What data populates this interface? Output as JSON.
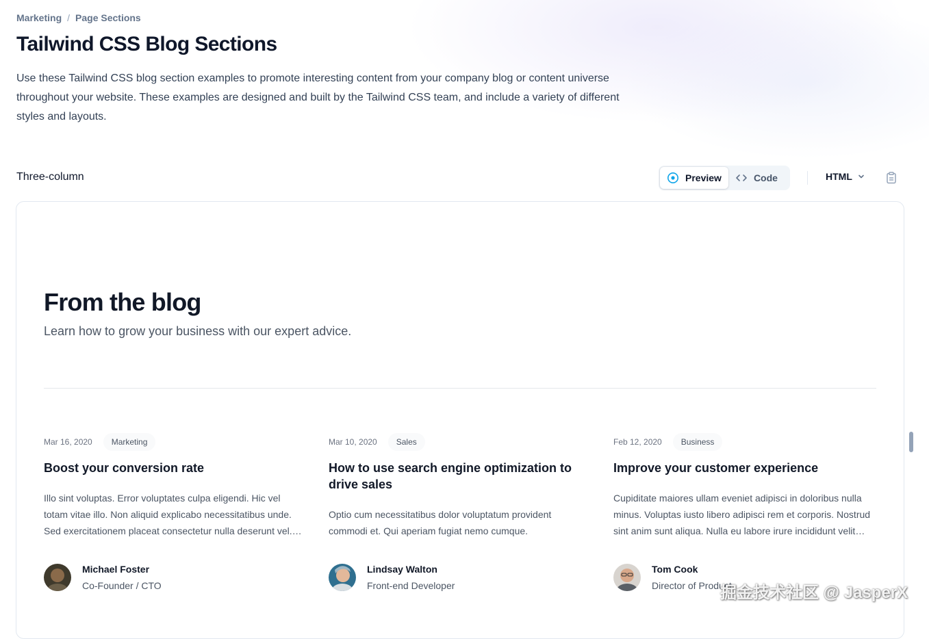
{
  "breadcrumb": {
    "items": [
      "Marketing",
      "Page Sections"
    ],
    "separator": "/"
  },
  "header": {
    "title": "Tailwind CSS Blog Sections",
    "description": "Use these Tailwind CSS blog section examples to promote interesting content from your company blog or content universe throughout your website. These examples are designed and built by the Tailwind CSS team, and include a variety of different styles and layouts."
  },
  "example": {
    "label": "Three-column",
    "tabs": [
      {
        "label": "Preview",
        "icon": "eye-icon",
        "active": true
      },
      {
        "label": "Code",
        "icon": "code-icon",
        "active": false
      }
    ],
    "language": {
      "selected": "HTML",
      "icon": "chevron-down-icon"
    },
    "copy_icon": "clipboard-icon"
  },
  "blog": {
    "title": "From the blog",
    "subtitle": "Learn how to grow your business with our expert advice.",
    "posts": [
      {
        "date": "Mar 16, 2020",
        "category": "Marketing",
        "title": "Boost your conversion rate",
        "excerpt": "Illo sint voluptas. Error voluptates culpa eligendi. Hic vel totam vitae illo. Non aliquid explicabo necessitatibus unde. Sed exercitationem placeat consectetur nulla deserunt vel. Iusto corrupti dicta.",
        "author": {
          "name": "Michael Foster",
          "role": "Co-Founder / CTO"
        }
      },
      {
        "date": "Mar 10, 2020",
        "category": "Sales",
        "title": "How to use search engine optimization to drive sales",
        "excerpt": "Optio cum necessitatibus dolor voluptatum provident commodi et. Qui aperiam fugiat nemo cumque.",
        "author": {
          "name": "Lindsay Walton",
          "role": "Front-end Developer"
        }
      },
      {
        "date": "Feb 12, 2020",
        "category": "Business",
        "title": "Improve your customer experience",
        "excerpt": "Cupiditate maiores ullam eveniet adipisci in doloribus nulla minus. Voluptas iusto libero adipisci rem et corporis. Nostrud sint anim sunt aliqua. Nulla eu labore irure incididunt velit cillum quis magna dolore.",
        "author": {
          "name": "Tom Cook",
          "role": "Director of Product"
        }
      }
    ]
  },
  "watermark": "掘金技术社区 @ JasperX",
  "colors": {
    "accent": "#0ea5e9",
    "heading": "#0f172a",
    "muted": "#4b5563",
    "border": "#e2e8f0"
  }
}
